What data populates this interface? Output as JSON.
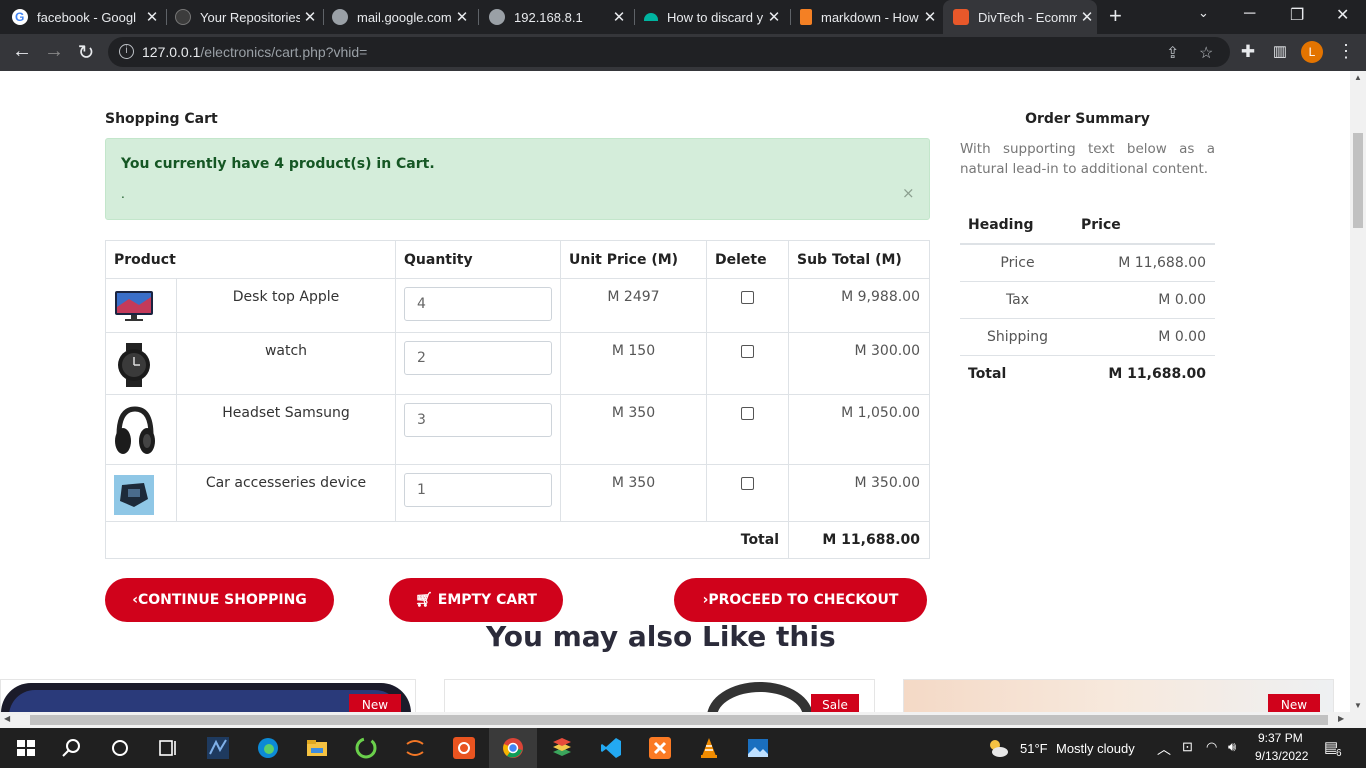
{
  "browser": {
    "tabs": [
      {
        "title": "facebook - Googl",
        "favicon_color": "#4285f4"
      },
      {
        "title": "Your Repositories",
        "favicon_color": "#24292e"
      },
      {
        "title": "mail.google.com",
        "favicon_color": "#9aa0a6"
      },
      {
        "title": "192.168.8.1",
        "favicon_color": "#9aa0a6"
      },
      {
        "title": "How to discard y",
        "favicon_color": "#00b4a0"
      },
      {
        "title": "markdown - How",
        "favicon_color": "#f48024"
      },
      {
        "title": "DivTech - Ecomm",
        "favicon_color": "#e8582a",
        "active": true
      }
    ],
    "new_tab": "+",
    "url_host": "127.0.0.1",
    "url_path": "/electronics/cart.php?vhid=",
    "profile_initial": "L"
  },
  "cart": {
    "title": "Shopping Cart",
    "alert_message": "You currently have 4 product(s) in Cart.",
    "alert_sub": ".",
    "alert_close": "×",
    "columns": [
      "Product",
      "Quantity",
      "Unit Price (M)",
      "Delete",
      "Sub Total (M)"
    ],
    "items": [
      {
        "name": "Desk top Apple",
        "qty": "4",
        "unit_price": "M 2497",
        "subtotal": "M 9,988.00",
        "image": "desktop-monitor"
      },
      {
        "name": "watch",
        "qty": "2",
        "unit_price": "M 150",
        "subtotal": "M 300.00",
        "image": "smart-watch"
      },
      {
        "name": "Headset Samsung",
        "qty": "3",
        "unit_price": "M 350",
        "subtotal": "M 1,050.00",
        "image": "headset"
      },
      {
        "name": "Car accesseries device",
        "qty": "1",
        "unit_price": "M 350",
        "subtotal": "M 350.00",
        "image": "car-device"
      }
    ],
    "total_label": "Total",
    "total_value": "M 11,688.00",
    "buttons": {
      "continue": "CONTINUE SHOPPING",
      "empty": "EMPTY CART",
      "checkout": "PROCEED TO CHECKOUT"
    }
  },
  "summary": {
    "title": "Order Summary",
    "text": "With supporting text below as a natural lead-in to additional content.",
    "col_heading": "Heading",
    "col_price": "Price",
    "rows": [
      {
        "label": "Price",
        "value": "M 11,688.00"
      },
      {
        "label": "Tax",
        "value": "M 0.00"
      },
      {
        "label": "Shipping",
        "value": "M 0.00"
      }
    ],
    "total_label": "Total",
    "total_value": "M 11,688.00"
  },
  "recommend": {
    "heading": "You may also Like this",
    "cards": [
      {
        "badge": "New"
      },
      {
        "badge": "Sale"
      },
      {
        "badge": "New"
      }
    ]
  },
  "taskbar": {
    "weather_temp": "51°F",
    "weather_desc": "Mostly cloudy",
    "time": "9:37 PM",
    "date": "9/13/2022",
    "notifications": "6"
  },
  "colors": {
    "accent": "#d0021b",
    "alert_bg": "#d4edda",
    "alert_text": "#155724"
  }
}
